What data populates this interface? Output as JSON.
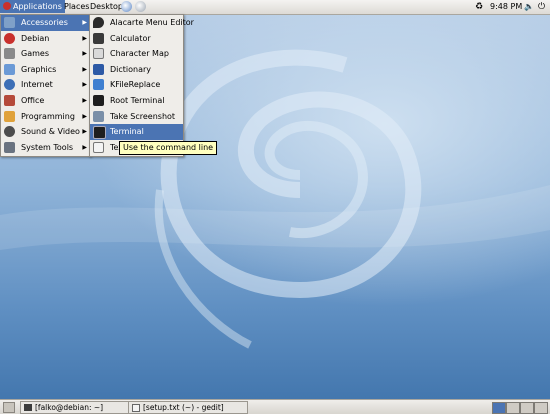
{
  "top_panel": {
    "menus": [
      "Applications",
      "Places",
      "Desktop"
    ],
    "clock": "9:48 PM",
    "icons": [
      "debian-logo-icon",
      "web-browser-icon",
      "mail-icon",
      "update-notifier-icon",
      "network-icon",
      "volume-icon",
      "power-icon"
    ]
  },
  "applications_menu": [
    {
      "label": "Accessories",
      "icon": "accessories-icon",
      "submenu": true,
      "active": true
    },
    {
      "label": "Debian",
      "icon": "debian-icon",
      "submenu": true
    },
    {
      "label": "Games",
      "icon": "games-icon",
      "submenu": true
    },
    {
      "label": "Graphics",
      "icon": "graphics-icon",
      "submenu": true
    },
    {
      "label": "Internet",
      "icon": "internet-icon",
      "submenu": true
    },
    {
      "label": "Office",
      "icon": "office-icon",
      "submenu": true
    },
    {
      "label": "Programming",
      "icon": "programming-icon",
      "submenu": true
    },
    {
      "label": "Sound & Video",
      "icon": "sound-video-icon",
      "submenu": true
    },
    {
      "label": "System Tools",
      "icon": "system-tools-icon",
      "submenu": true
    }
  ],
  "accessories_menu": [
    {
      "label": "Alacarte Menu Editor",
      "icon": "alacarte-icon"
    },
    {
      "label": "Calculator",
      "icon": "calculator-icon"
    },
    {
      "label": "Character Map",
      "icon": "character-map-icon"
    },
    {
      "label": "Dictionary",
      "icon": "dictionary-icon"
    },
    {
      "label": "KFileReplace",
      "icon": "kfilereplace-icon"
    },
    {
      "label": "Root Terminal",
      "icon": "root-terminal-icon"
    },
    {
      "label": "Take Screenshot",
      "icon": "screenshot-icon"
    },
    {
      "label": "Terminal",
      "icon": "terminal-icon",
      "highlighted": true
    },
    {
      "label": "Text",
      "icon": "text-editor-icon"
    }
  ],
  "tooltip": "Use the command line",
  "taskbar": {
    "tasks": [
      "[falko@debian: ~]",
      "[setup.txt (~) - gedit]"
    ],
    "workspaces": 4
  },
  "colors": {
    "highlight": "#4b74b3",
    "panel": "#e8e6e2",
    "tooltip": "#ffffbf"
  }
}
